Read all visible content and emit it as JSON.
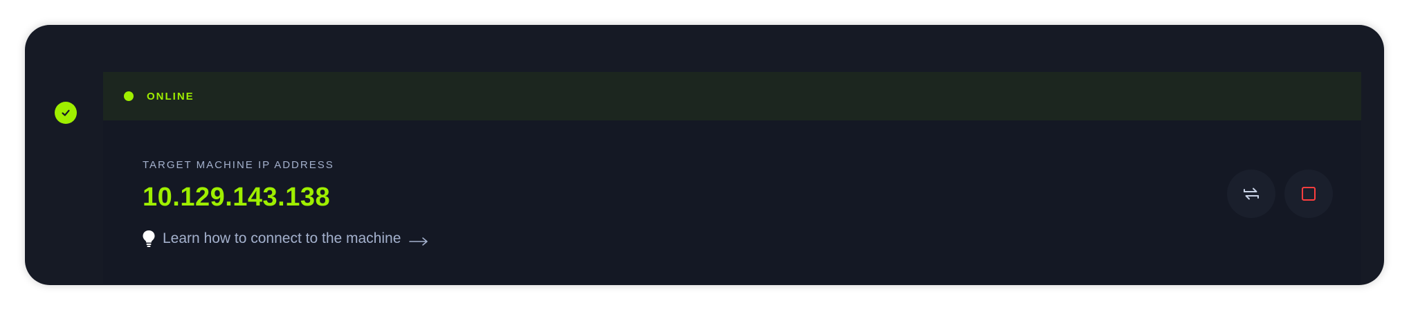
{
  "status": {
    "label": "ONLINE",
    "color": "#9fef00"
  },
  "machine": {
    "ip_label": "TARGET MACHINE IP ADDRESS",
    "ip_address": "10.129.143.138"
  },
  "help_link": {
    "label": "Learn how to connect to the machine",
    "icon": "lightbulb-icon",
    "trailing_icon": "arrow-right-icon"
  },
  "actions": {
    "reset_icon": "reset-icon",
    "stop_icon": "stop-icon",
    "stop_color": "#ff3e3e"
  },
  "badge": {
    "icon": "check-icon",
    "color": "#9fef00"
  },
  "colors": {
    "card_bg": "#161a25",
    "status_bg": "#1c261f",
    "accent": "#9fef00",
    "muted_text": "#a4b1cd"
  }
}
